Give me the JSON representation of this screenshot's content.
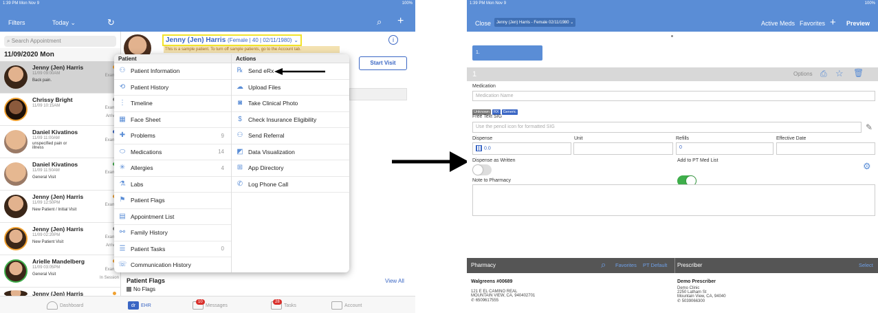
{
  "left": {
    "status_time": "1:39 PM  Mon Nov 9",
    "status_right": "100%",
    "filters": "Filters",
    "today": "Today",
    "search_placeholder": "Search Appointment",
    "date_header": "11/09/2020 Mon",
    "patient_header": "Jenny (Jen) Harris",
    "patient_meta": "(Female | 40 | 02/11/1980)",
    "sample_notice": "This is a sample patient. To turn off sample patients, go to the Account tab.",
    "start_visit": "Start Visit",
    "appointments": [
      {
        "name": "Jenny (Jen) Harris",
        "time": "11/09 09:00AM",
        "exam": "Exam 3",
        "reason": "Back pain.",
        "status": ""
      },
      {
        "name": "Chrissy Bright",
        "time": "11/09 10:15AM",
        "exam": "Exam 4",
        "reason": "",
        "status": "Arrived"
      },
      {
        "name": "Daniel Kivatinos",
        "time": "11/09 11:00AM",
        "exam": "Exam 2",
        "reason": "unspecified pain or illness",
        "status": ""
      },
      {
        "name": "Daniel Kivatinos",
        "time": "11/09 11:50AM",
        "exam": "Exam 1",
        "reason": "General Visit",
        "status": ""
      },
      {
        "name": "Jenny (Jen) Harris",
        "time": "11/09 12:50PM",
        "exam": "Exam 1",
        "reason": "New Patient / Initial Visit",
        "status": ""
      },
      {
        "name": "Jenny (Jen) Harris",
        "time": "11/09 02:20PM",
        "exam": "Exam 1",
        "reason": "New Patient Visit",
        "status": "Arrived"
      },
      {
        "name": "Arielle Mandelberg",
        "time": "11/09 03:05PM",
        "exam": "Exam 2",
        "reason": "General Visit",
        "status": "In Session"
      },
      {
        "name": "Jenny (Jen) Harris",
        "time": "",
        "exam": "",
        "reason": "",
        "status": ""
      }
    ],
    "menu": {
      "patient_header": "Patient",
      "actions_header": "Actions",
      "patient_items": [
        {
          "label": "Patient Information",
          "count": ""
        },
        {
          "label": "Patient History",
          "count": ""
        },
        {
          "label": "Timeline",
          "count": ""
        },
        {
          "label": "Face Sheet",
          "count": ""
        },
        {
          "label": "Problems",
          "count": "9"
        },
        {
          "label": "Medications",
          "count": "14"
        },
        {
          "label": "Allergies",
          "count": "4"
        },
        {
          "label": "Labs",
          "count": ""
        },
        {
          "label": "Patient Flags",
          "count": ""
        },
        {
          "label": "Appointment List",
          "count": ""
        },
        {
          "label": "Family History",
          "count": ""
        },
        {
          "label": "Patient Tasks",
          "count": "0"
        },
        {
          "label": "Communication History",
          "count": ""
        }
      ],
      "action_items": [
        "Send eRx",
        "Upload Files",
        "Take Clinical Photo",
        "Check Insurance Eligibility",
        "Send Referral",
        "Data Visualization",
        "App Directory",
        "Log Phone Call"
      ]
    },
    "patient_flags_label": "Patient Flags",
    "no_flags": "No Flags",
    "view_all": "View All",
    "tabs": {
      "dashboard": "Dashboard",
      "ehr": "EHR",
      "messages": "Messages",
      "tasks": "Tasks",
      "account": "Account",
      "messages_badge": "10",
      "tasks_badge": "28"
    }
  },
  "right": {
    "status_time": "1:39 PM  Mon Nov 9",
    "status_right": "100%",
    "close": "Close",
    "patient_pill": "Jenny (Jen) Harris - Female 02/11/1980",
    "active_meds": "Active Meds",
    "favorites": "Favorites",
    "preview": "Preview",
    "tab_item": "1.",
    "section_num": "1",
    "options": "Options",
    "medication_label": "Medication",
    "medication_placeholder": "Medication Name",
    "tags": [
      "Unknown",
      "RX",
      "Generic"
    ],
    "sig_label": "Free Text SIG",
    "sig_placeholder": "Use the pencil icon for formatted SIG",
    "dispense_label": "Dispense",
    "unit_label": "Unit",
    "refills_label": "Refills",
    "effective_label": "Effective Date",
    "dispense_value": "0.0",
    "refills_value": "0",
    "daw_label": "Dispense as Written",
    "add_pt_label": "Add to PT Med List",
    "note_label": "Note to Pharmacy",
    "pharmacy_label": "Pharmacy",
    "pharm_favorites": "Favorites",
    "pt_default": "PT Default",
    "prescriber_label": "Prescriber",
    "select": "Select",
    "pharmacy": {
      "name": "Walgreens #00689",
      "addr1": "121 E EL CAMINO REAL",
      "addr2": "MOUNTAIN VIEW, CA, 940402701",
      "phone": "6509617555"
    },
    "prescriber": {
      "name": "Demo Prescriber",
      "clinic": "Demo Clinic",
      "addr1": "2250 Latham St",
      "addr2": "Mountain View, CA, 94040",
      "phone": "5039066300"
    }
  },
  "colors": {
    "brand_blue": "#5a8dd6",
    "green": "#3fae4b",
    "badge_red": "#d9302c"
  }
}
